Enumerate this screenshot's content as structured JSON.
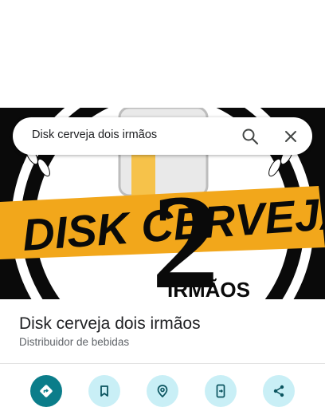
{
  "search": {
    "query": "Disk cerveja dois irmãos"
  },
  "hero": {
    "logo_text": "DISK CERVEJA",
    "logo_subtext": "IRMÃOS",
    "logo_number": "2"
  },
  "place": {
    "name": "Disk cerveja dois irmãos",
    "category": "Distribuidor de bebidas"
  },
  "actions": [
    {
      "icon": "directions-icon"
    },
    {
      "icon": "bookmark-icon"
    },
    {
      "icon": "nearby-icon"
    },
    {
      "icon": "send-to-phone-icon"
    },
    {
      "icon": "share-icon"
    }
  ],
  "colors": {
    "accent": "#0b7d8a",
    "chip_bg": "#c9eff6",
    "logo_yellow": "#f2a71b"
  }
}
